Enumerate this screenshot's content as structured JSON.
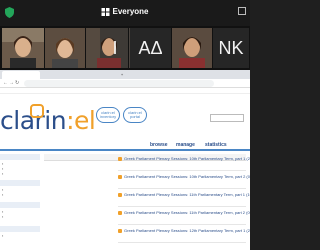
{
  "meeting": {
    "view_label": "Everyone",
    "tiles": [
      {
        "kind": "video",
        "name": "participant-1"
      },
      {
        "kind": "video",
        "name": "participant-2"
      },
      {
        "kind": "video",
        "name": "participant-3"
      },
      {
        "kind": "initials",
        "text": "I"
      },
      {
        "kind": "initials",
        "text": "ΑΔ"
      },
      {
        "kind": "video",
        "name": "participant-6"
      },
      {
        "kind": "initials",
        "text": "NK"
      }
    ]
  },
  "page": {
    "logo_text": "clarin",
    "logo_suffix": ":el",
    "bubble_inventory": "clarin:el inventory",
    "bubble_portal": "clarin:el portal",
    "nav": [
      "browse",
      "manage",
      "statistics"
    ],
    "results": [
      "Greek Parliament Plenary Sessions: 10th Parliamentary Term, part 1 (29.04.2000_11.12.2001)",
      "Greek Parliament Plenary Sessions: 10th Parliamentary Term, part 2 (07.01.2000_10.03.2004)",
      "Greek Parliament Plenary Sessions: 11th Parliamentary Term, part 1 (19.03.2004_13.10.2005)",
      "Greek Parliament Plenary Sessions: 11th Parliamentary Term, part 2 (09.01.2006_03.08.2007)",
      "Greek Parliament Plenary Sessions: 12th Parliamentary Term, part 1 (26.09.2007_23.12.2008)"
    ]
  },
  "colors": {
    "brand_blue": "#2b4e8a",
    "accent_orange": "#f0a02a",
    "link_blue": "#4a86c5"
  }
}
